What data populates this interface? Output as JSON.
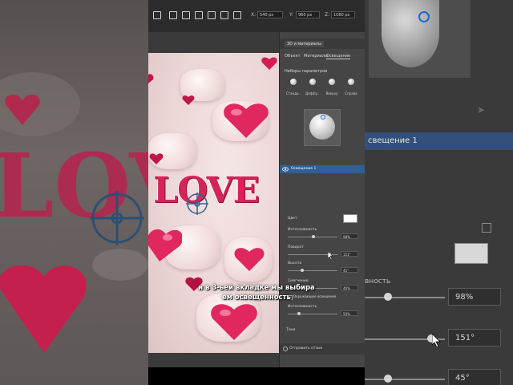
{
  "toolbar": {
    "x_label": "X:",
    "x_value": "540 px",
    "y_label": "Y:",
    "y_value": "960 px",
    "z_label": "Z:",
    "z_value": "1080 px"
  },
  "panel": {
    "title": "3D и материалы",
    "tabs": [
      "Объект",
      "Материалы",
      "Освещение"
    ],
    "presets_label": "Наборы параметров",
    "presets": [
      "Станда...",
      "Диффу...",
      "Вверху",
      "Справа"
    ],
    "layer_name": "Освещение 1",
    "color_label": "Цвет",
    "color_value": "#ffffff",
    "intensity_label": "Интенсивность",
    "intensity_value": "98%",
    "rotation_label": "Поворот",
    "rotation_value": "151°",
    "height_label": "Высота",
    "height_value": "45°",
    "softness_label": "Смягчение",
    "softness_value": "40%",
    "ambient_label": "Окружающее освещение",
    "ambient_intensity_label": "Интенсивность",
    "ambient_intensity_value": "50%",
    "shadows_label": "Тени",
    "feedback_label": "Отправить отзыв"
  },
  "canvas": {
    "word": "LOVE",
    "accent_color": "#d6245a"
  },
  "subtitle": {
    "line1": "и в 3-ьей вкладке мы выбира",
    "line2": "ем освещенность"
  },
  "right_panel": {
    "layer_label": "свещение 1",
    "intensity_label": "вность",
    "intensity_value": "98%",
    "rotation_value": "151°",
    "height_value": "45°"
  }
}
